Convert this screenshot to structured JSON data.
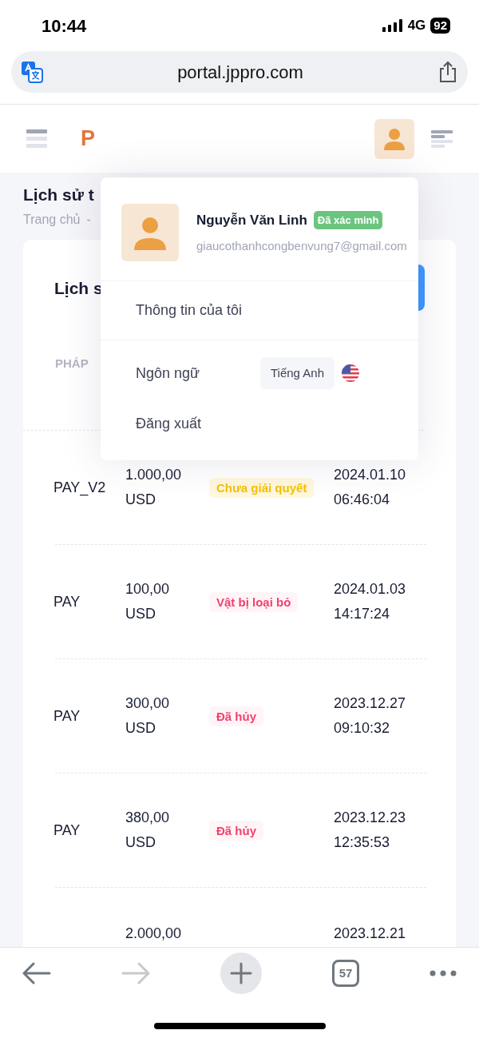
{
  "status_bar": {
    "time": "10:44",
    "network": "4G",
    "battery": "92"
  },
  "browser": {
    "url": "portal.jppro.com"
  },
  "app_header": {
    "logo": "P"
  },
  "page": {
    "title": "Lịch sử t",
    "breadcrumb": [
      "Trang chủ",
      "-"
    ]
  },
  "card": {
    "title": "Lịch s",
    "columns": [
      "PHÁP"
    ],
    "rows": [
      {
        "method": "PAY_V2",
        "amount": [
          "1.000,00",
          "USD"
        ],
        "status": {
          "label": "Chưa giải quyết",
          "kind": "pending"
        },
        "date": [
          "2024.01.10",
          "06:46:04"
        ]
      },
      {
        "method": "PAY",
        "amount": [
          "100,00",
          "USD"
        ],
        "status": {
          "label": "Vật bị loại bỏ",
          "kind": "rejected"
        },
        "date": [
          "2024.01.03",
          "14:17:24"
        ]
      },
      {
        "method": "PAY",
        "amount": [
          "300,00",
          "USD"
        ],
        "status": {
          "label": "Đã hủy",
          "kind": "cancelled"
        },
        "date": [
          "2023.12.27",
          "09:10:32"
        ]
      },
      {
        "method": "PAY",
        "amount": [
          "380,00",
          "USD"
        ],
        "status": {
          "label": "Đã hủy",
          "kind": "cancelled"
        },
        "date": [
          "2023.12.23",
          "12:35:53"
        ]
      },
      {
        "amount": [
          "2.000,00"
        ],
        "date": [
          "2023.12.21"
        ]
      }
    ]
  },
  "user_menu": {
    "name": "Nguyễn Văn Linh",
    "badge": "Đã xác minh",
    "email": "giaucothanhcongbenvung7@gmail.com",
    "items": [
      {
        "kind": "link",
        "label": "Thông tin của tôi"
      },
      {
        "kind": "language",
        "label": "Ngôn ngữ",
        "value": "Tiếng Anh"
      },
      {
        "kind": "link",
        "label": "Đăng xuất"
      }
    ]
  },
  "toolbar": {
    "forward_disabled": true,
    "tab_count": "57"
  }
}
